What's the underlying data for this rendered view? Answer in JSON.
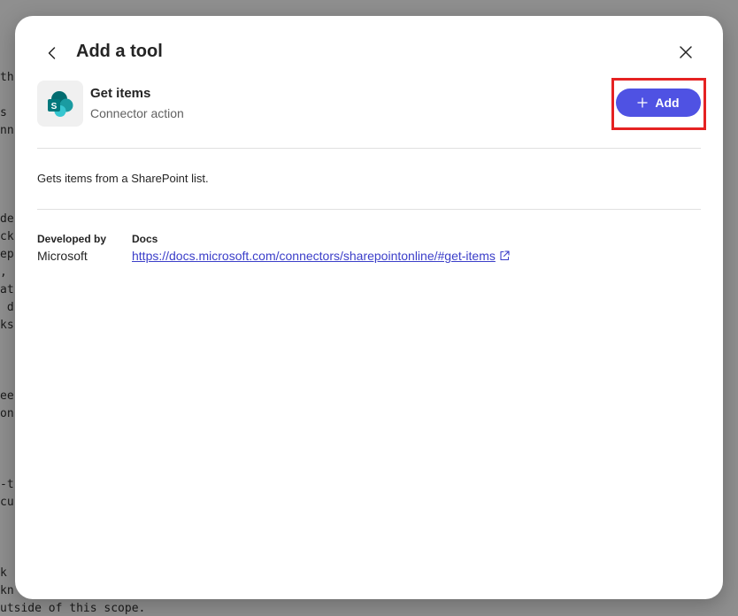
{
  "background": {
    "lines": [
      "th",
      "s",
      "nn",
      "de",
      "ck",
      "ep",
      ",",
      "at",
      " d",
      "ks",
      "ee",
      "on",
      "-t",
      "cu",
      "k",
      "kn",
      "utside of this scope."
    ]
  },
  "modal": {
    "title": "Add a tool",
    "tool": {
      "name": "Get items",
      "type": "Connector action",
      "icon": "sharepoint-icon"
    },
    "add_button": {
      "label": "Add",
      "color": "#4f52e3"
    },
    "highlight_color": "#e52222",
    "description": "Gets items from a SharePoint list.",
    "developed_by": {
      "label": "Developed by",
      "value": "Microsoft"
    },
    "docs": {
      "label": "Docs",
      "link_text": "https://docs.microsoft.com/connectors/sharepointonline/#get-items"
    }
  }
}
